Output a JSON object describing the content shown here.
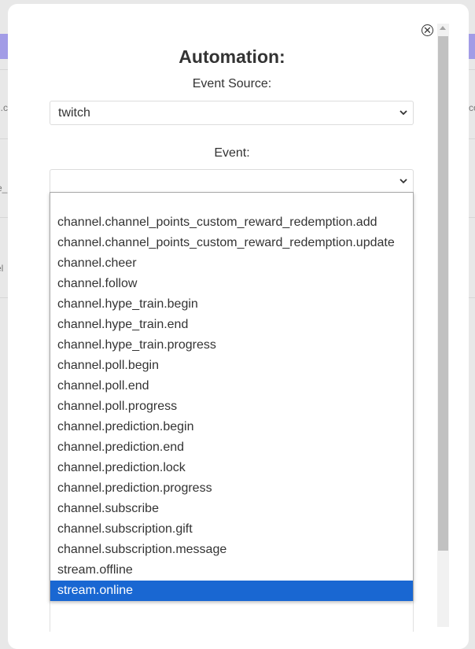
{
  "background": {
    "fragments": [
      "n.c",
      "co",
      "e_",
      "el"
    ]
  },
  "modal": {
    "title": "Automation:",
    "close_icon": "close-circle-icon",
    "event_source": {
      "label": "Event Source:",
      "value": "twitch"
    },
    "event": {
      "label": "Event:",
      "value": "",
      "options": [
        "",
        "channel.channel_points_custom_reward_redemption.add",
        "channel.channel_points_custom_reward_redemption.update",
        "channel.cheer",
        "channel.follow",
        "channel.hype_train.begin",
        "channel.hype_train.end",
        "channel.hype_train.progress",
        "channel.poll.begin",
        "channel.poll.end",
        "channel.poll.progress",
        "channel.prediction.begin",
        "channel.prediction.end",
        "channel.prediction.lock",
        "channel.prediction.progress",
        "channel.subscribe",
        "channel.subscription.gift",
        "channel.subscription.message",
        "stream.offline",
        "stream.online"
      ],
      "highlighted": "stream.online"
    }
  },
  "colors": {
    "highlight": "#1967d2",
    "accent_bar": "#a29ce6"
  }
}
